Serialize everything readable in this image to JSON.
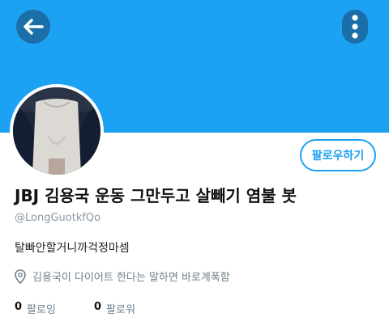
{
  "header": {
    "back_icon": "arrow-left-icon",
    "menu_icon": "vertical-dots-icon",
    "banner_color": "#1da1f2"
  },
  "profile": {
    "follow_label": "팔로우하기",
    "display_name": "JBJ 김용국 운동 그만두고 살빼기 염불 봇",
    "handle": "@LongGuotkfQo",
    "bio": "탈빠안할거니까걱정마셈",
    "location": "김용국이 다이어트 한다는 말하면 바로계폭함",
    "following_count": "0",
    "following_label": "팔로잉",
    "followers_count": "0",
    "followers_label": "팔로워"
  },
  "accent_color": "#1da1f2"
}
